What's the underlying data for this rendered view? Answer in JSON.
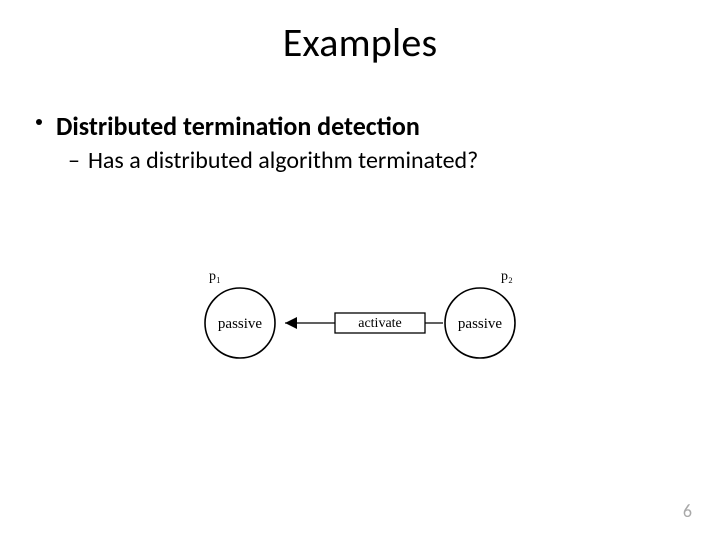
{
  "title": "Examples",
  "bullets": {
    "main": "Distributed termination detection",
    "sub": "Has a distributed algorithm terminated?"
  },
  "diagram": {
    "left_node": {
      "id": "p₁",
      "state": "passive"
    },
    "right_node": {
      "id": "p₂",
      "state": "passive"
    },
    "edge_label": "activate"
  },
  "page_number": "6"
}
